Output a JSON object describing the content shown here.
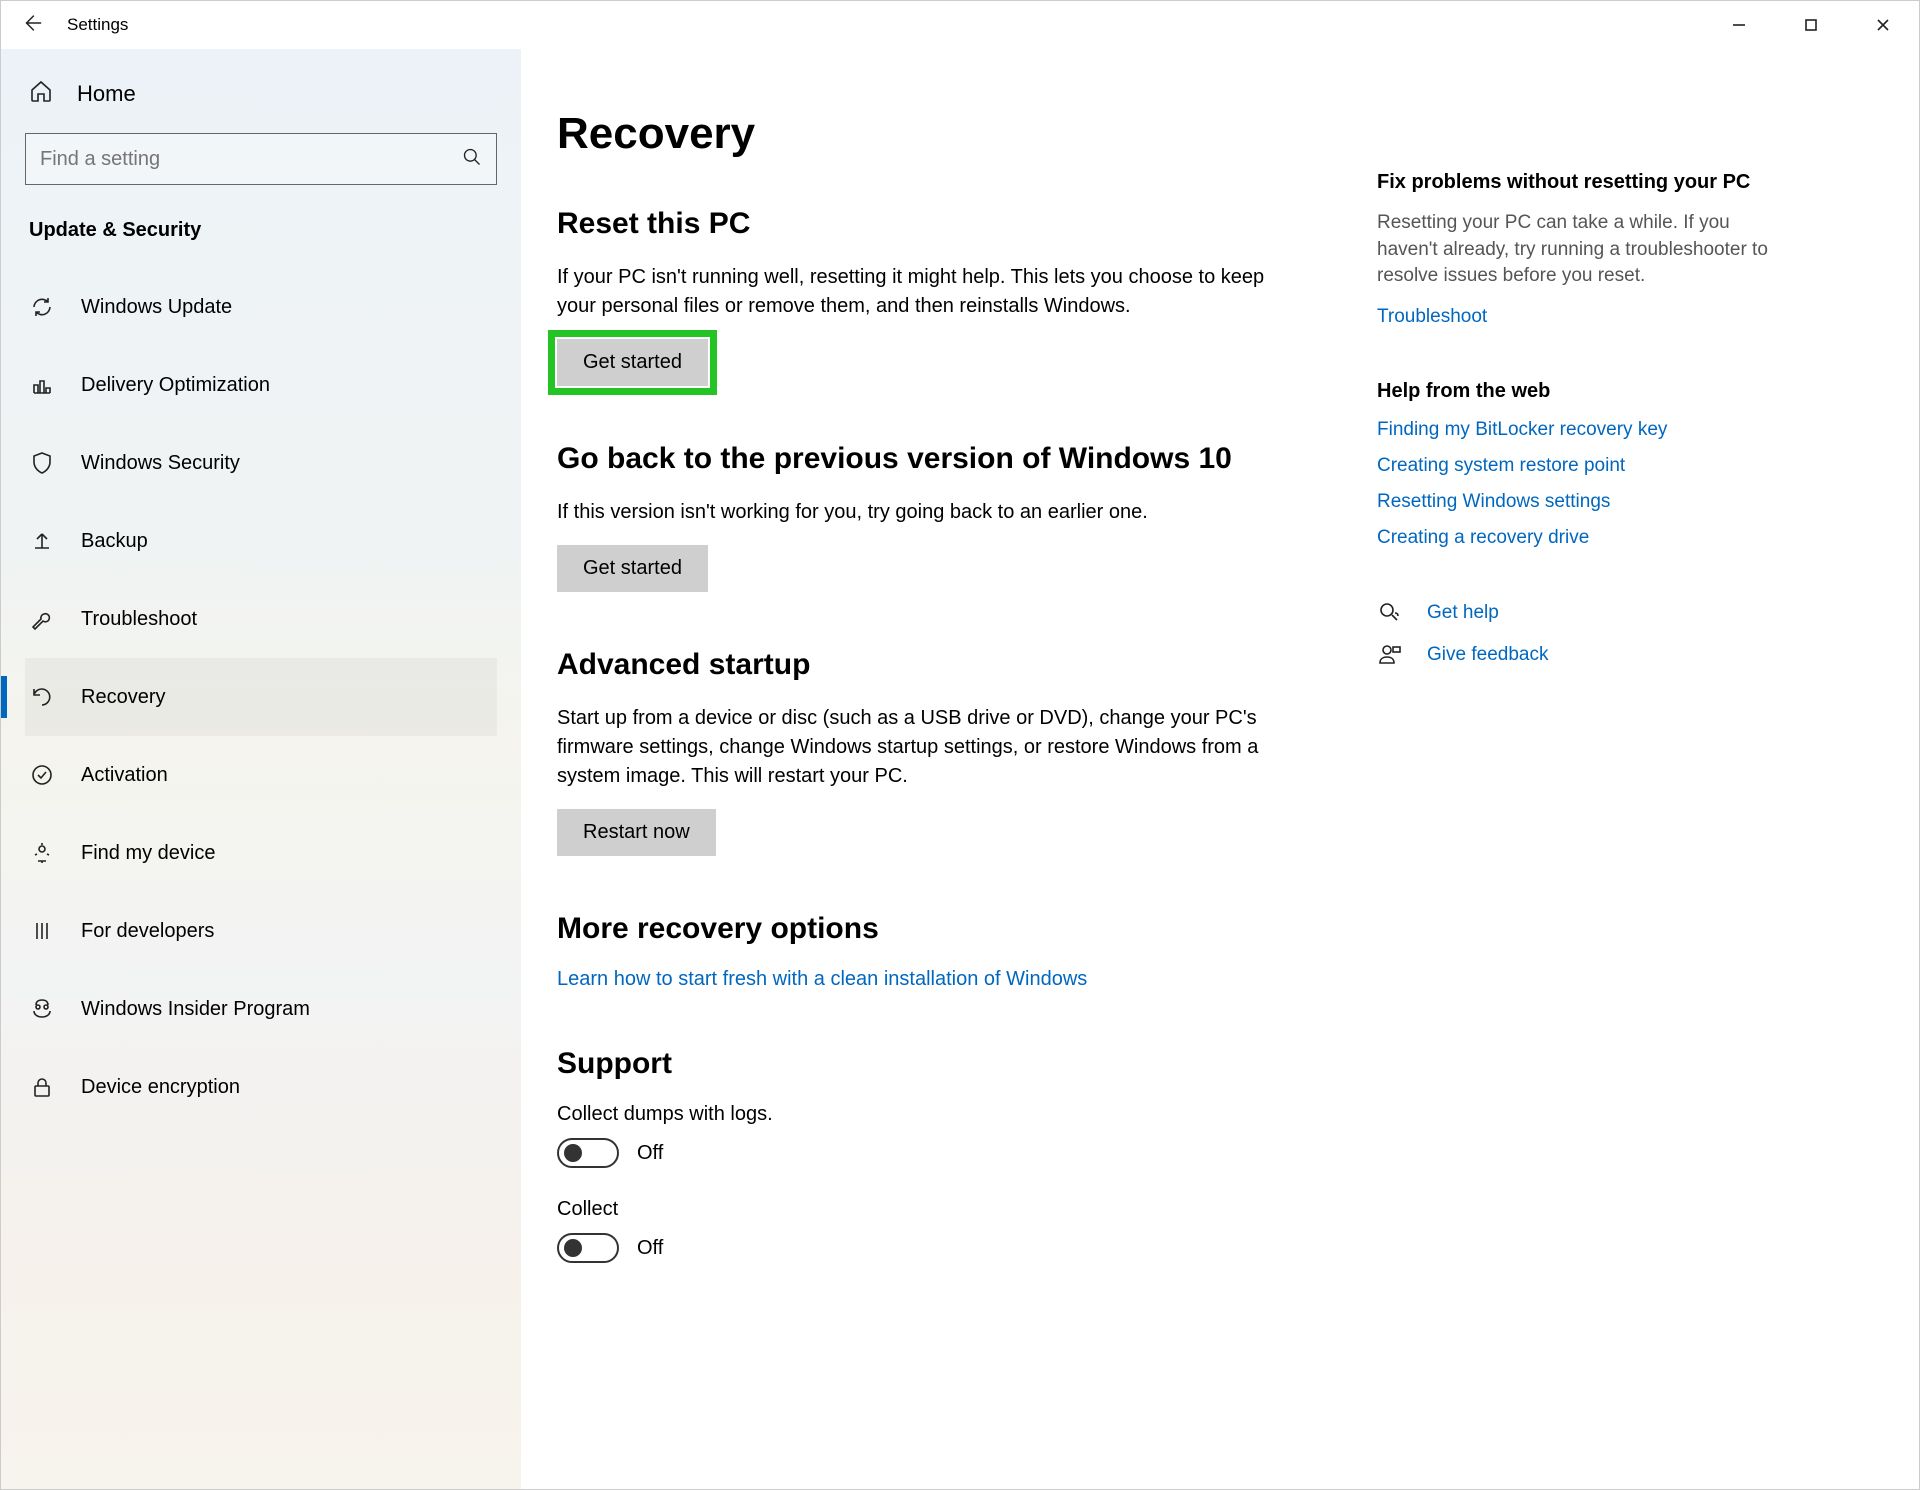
{
  "titlebar": {
    "title": "Settings"
  },
  "sidebar": {
    "home": "Home",
    "search_placeholder": "Find a setting",
    "section": "Update & Security",
    "items": [
      {
        "label": "Windows Update"
      },
      {
        "label": "Delivery Optimization"
      },
      {
        "label": "Windows Security"
      },
      {
        "label": "Backup"
      },
      {
        "label": "Troubleshoot"
      },
      {
        "label": "Recovery"
      },
      {
        "label": "Activation"
      },
      {
        "label": "Find my device"
      },
      {
        "label": "For developers"
      },
      {
        "label": "Windows Insider Program"
      },
      {
        "label": "Device encryption"
      }
    ]
  },
  "page": {
    "title": "Recovery",
    "reset": {
      "heading": "Reset this PC",
      "desc": "If your PC isn't running well, resetting it might help. This lets you choose to keep your personal files or remove them, and then reinstalls Windows.",
      "button": "Get started"
    },
    "goback": {
      "heading": "Go back to the previous version of Windows 10",
      "desc": "If this version isn't working for you, try going back to an earlier one.",
      "button": "Get started"
    },
    "advanced": {
      "heading": "Advanced startup",
      "desc": "Start up from a device or disc (such as a USB drive or DVD), change your PC's firmware settings, change Windows startup settings, or restore Windows from a system image. This will restart your PC.",
      "button": "Restart now"
    },
    "more": {
      "heading": "More recovery options",
      "link": "Learn how to start fresh with a clean installation of Windows"
    },
    "support": {
      "heading": "Support",
      "dumps_label": "Collect dumps with logs.",
      "dumps_state": "Off",
      "collect_label": "Collect",
      "collect_state": "Off"
    }
  },
  "aside": {
    "fix": {
      "heading": "Fix problems without resetting your PC",
      "desc": "Resetting your PC can take a while. If you haven't already, try running a troubleshooter to resolve issues before you reset.",
      "link": "Troubleshoot"
    },
    "web": {
      "heading": "Help from the web",
      "links": [
        "Finding my BitLocker recovery key",
        "Creating system restore point",
        "Resetting Windows settings",
        "Creating a recovery drive"
      ]
    },
    "help": "Get help",
    "feedback": "Give feedback"
  }
}
